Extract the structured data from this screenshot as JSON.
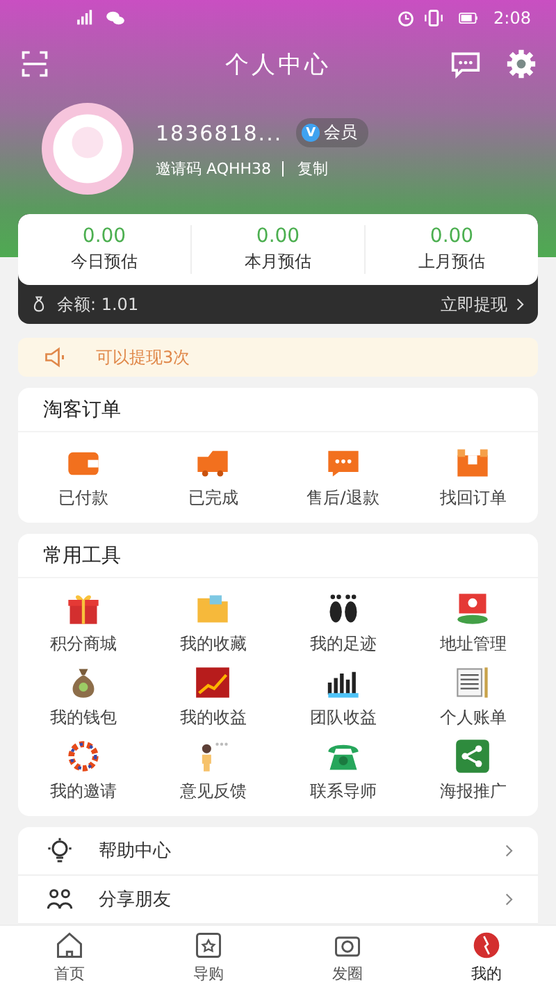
{
  "status_bar": {
    "time": "2:08"
  },
  "header": {
    "title": "个人中心"
  },
  "profile": {
    "name": "1836818...",
    "badge_icon": "V",
    "badge": "会员",
    "invite": "邀请码 AQHH38",
    "copy": "复制"
  },
  "stats": [
    {
      "value": "0.00",
      "label": "今日预估"
    },
    {
      "value": "0.00",
      "label": "本月预估"
    },
    {
      "value": "0.00",
      "label": "上月预估"
    }
  ],
  "balance": {
    "label": "余额: 1.01",
    "action": "立即提现"
  },
  "notice": {
    "text": "可以提现3次"
  },
  "orders": {
    "title": "淘客订单",
    "items": [
      {
        "label": "已付款"
      },
      {
        "label": "已完成"
      },
      {
        "label": "售后/退款"
      },
      {
        "label": "找回订单"
      }
    ]
  },
  "tools": {
    "title": "常用工具",
    "items": [
      {
        "label": "积分商城"
      },
      {
        "label": "我的收藏"
      },
      {
        "label": "我的足迹"
      },
      {
        "label": "地址管理"
      },
      {
        "label": "我的钱包"
      },
      {
        "label": "我的收益"
      },
      {
        "label": "团队收益"
      },
      {
        "label": "个人账单"
      },
      {
        "label": "我的邀请"
      },
      {
        "label": "意见反馈"
      },
      {
        "label": "联系导师"
      },
      {
        "label": "海报推广"
      }
    ]
  },
  "links": [
    {
      "label": "帮助中心"
    },
    {
      "label": "分享朋友"
    }
  ],
  "tab_bar": [
    {
      "label": "首页",
      "selected": false
    },
    {
      "label": "导购",
      "selected": false
    },
    {
      "label": "发圈",
      "selected": false
    },
    {
      "label": "我的",
      "selected": true
    }
  ]
}
